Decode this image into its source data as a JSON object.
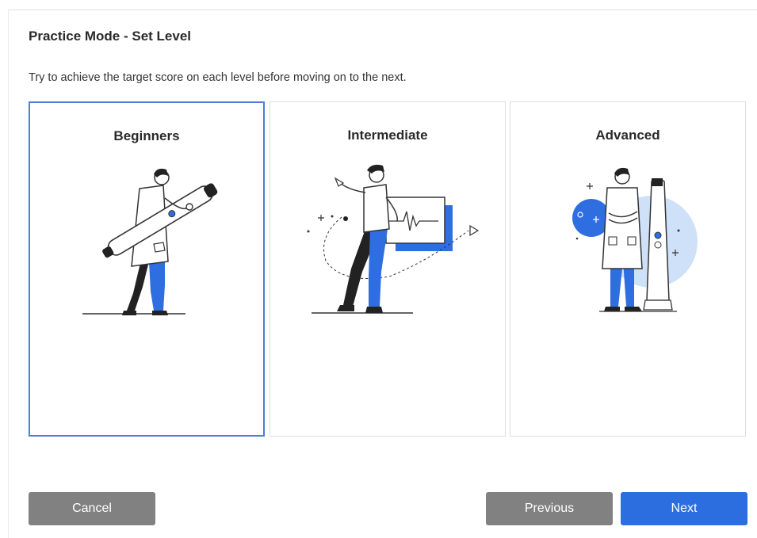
{
  "dialog": {
    "title": "Practice Mode - Set Level",
    "subtitle": "Try to achieve the target score on each level before moving on to the next."
  },
  "levels": [
    {
      "label": "Beginners",
      "selected": true,
      "illustration": "person-holding-scanner-illustration"
    },
    {
      "label": "Intermediate",
      "selected": false,
      "illustration": "person-with-graph-illustration"
    },
    {
      "label": "Advanced",
      "selected": false,
      "illustration": "person-with-scanner-stand-illustration"
    }
  ],
  "buttons": {
    "cancel": "Cancel",
    "previous": "Previous",
    "next": "Next"
  },
  "colors": {
    "accent": "#2c6ee0",
    "selected_border": "#4a7ed9",
    "button_gray": "#818181",
    "illustration_blue": "#2f6ee0",
    "illustration_light_blue": "#cfe1f8"
  }
}
